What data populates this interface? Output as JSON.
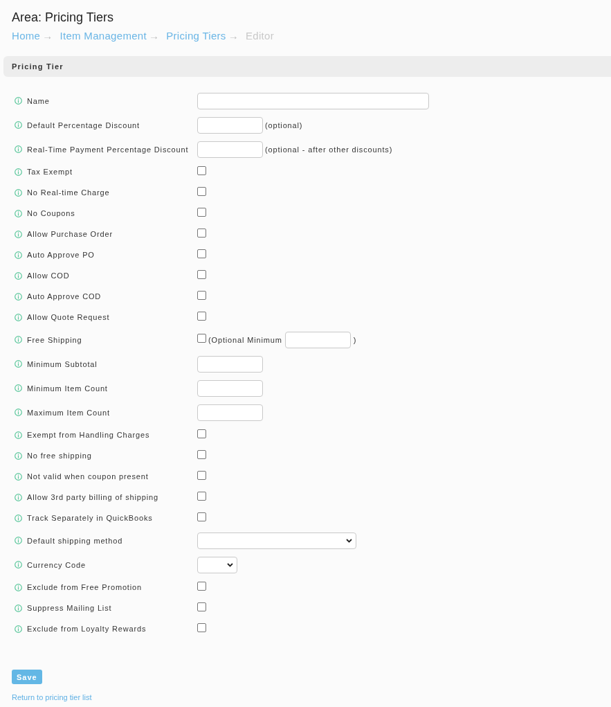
{
  "page": {
    "title": "Area: Pricing Tiers"
  },
  "breadcrumb": [
    {
      "label": "Home",
      "current": false,
      "separator": "→"
    },
    {
      "label": "Item Management",
      "current": false,
      "separator": "→"
    },
    {
      "label": "Pricing Tiers",
      "current": false,
      "separator": "→"
    },
    {
      "label": "Editor",
      "current": true
    }
  ],
  "panel": {
    "title": "Pricing Tier"
  },
  "fields": [
    {
      "label": "Name",
      "kind": "wide_text"
    },
    {
      "label": "Default Percentage Discount",
      "kind": "short_text",
      "note": "(optional)"
    },
    {
      "label": "Real-Time Payment Percentage Discount",
      "kind": "short_text",
      "note": "(optional - after other discounts)"
    },
    {
      "label": "Tax Exempt",
      "kind": "checkbox",
      "checked": false
    },
    {
      "label": "No Real-time Charge",
      "kind": "checkbox",
      "checked": false
    },
    {
      "label": "No Coupons",
      "kind": "checkbox",
      "checked": false
    },
    {
      "label": "Allow Purchase Order",
      "kind": "checkbox",
      "checked": false
    },
    {
      "label": "Auto Approve PO",
      "kind": "checkbox",
      "checked": false
    },
    {
      "label": "Allow COD",
      "kind": "checkbox",
      "checked": false
    },
    {
      "label": "Auto Approve COD",
      "kind": "checkbox",
      "checked": false
    },
    {
      "label": "Allow Quote Request",
      "kind": "checkbox",
      "checked": false
    },
    {
      "label": "Free Shipping",
      "kind": "checkbox_minimum",
      "checked": false,
      "note": "(Optional Minimum",
      "closing": ")"
    },
    {
      "label": "Minimum Subtotal",
      "kind": "short_text"
    },
    {
      "label": "Minimum Item Count",
      "kind": "short_text"
    },
    {
      "label": "Maximum Item Count",
      "kind": "short_text"
    },
    {
      "label": "Exempt from Handling Charges",
      "kind": "checkbox",
      "checked": false
    },
    {
      "label": "No free shipping",
      "kind": "checkbox",
      "checked": false
    },
    {
      "label": "Not valid when coupon present",
      "kind": "checkbox",
      "checked": false
    },
    {
      "label": "Allow 3rd party billing of shipping",
      "kind": "checkbox",
      "checked": false
    },
    {
      "label": "Track Separately in QuickBooks",
      "kind": "checkbox",
      "checked": false
    },
    {
      "label": "Default shipping method",
      "kind": "wide_select"
    },
    {
      "label": "Currency Code",
      "kind": "narrow_select"
    },
    {
      "label": "Exclude from Free Promotion",
      "kind": "checkbox",
      "checked": false
    },
    {
      "label": "Suppress Mailing List",
      "kind": "checkbox",
      "checked": false
    },
    {
      "label": "Exclude from Loyalty Rewards",
      "kind": "checkbox",
      "checked": false
    }
  ],
  "save_button": "Save",
  "return_link": "Return to pricing tier list"
}
